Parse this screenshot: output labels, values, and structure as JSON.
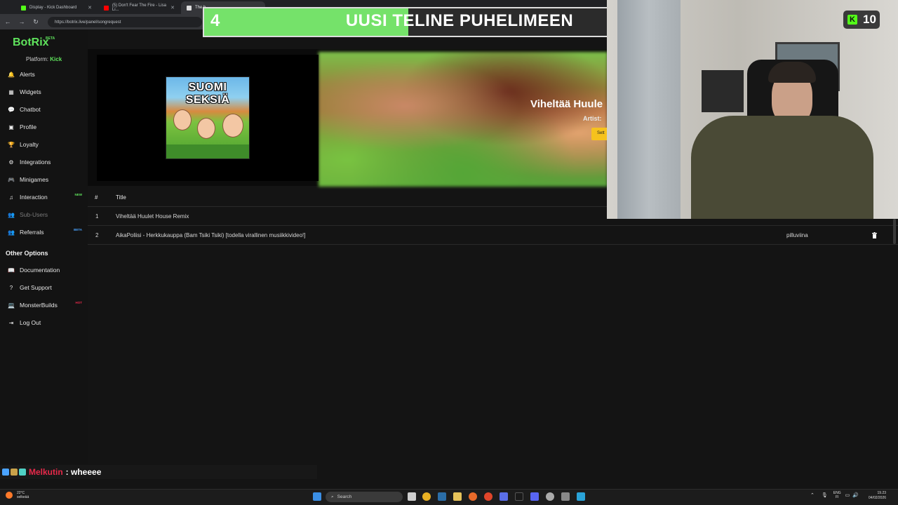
{
  "browser": {
    "tabs": [
      {
        "label": "Display - Kick Dashboard",
        "color": "#53fc18"
      },
      {
        "label": "(5) Don't Fear The Fire - Lisa Li...",
        "color": "#ff0000"
      },
      {
        "label": "The b...",
        "color": "#dddddd"
      }
    ],
    "url": "https://botrix.live/panel/songrequest"
  },
  "brand": {
    "name": "BotRix",
    "beta": "BETA"
  },
  "platform": {
    "label": "Platform:",
    "value": "Kick"
  },
  "nav": {
    "items": [
      {
        "label": "Alerts",
        "icon": "bell-icon",
        "glyph": "🔔"
      },
      {
        "label": "Widgets",
        "icon": "grid-icon",
        "glyph": "▦"
      },
      {
        "label": "Chatbot",
        "icon": "chat-icon",
        "glyph": "💬"
      },
      {
        "label": "Profile",
        "icon": "profile-icon",
        "glyph": "▣"
      },
      {
        "label": "Loyalty",
        "icon": "trophy-icon",
        "glyph": "🏆"
      },
      {
        "label": "Integrations",
        "icon": "integrations-icon",
        "glyph": "⚙"
      },
      {
        "label": "Minigames",
        "icon": "gamepad-icon",
        "glyph": "🎮"
      },
      {
        "label": "Interaction",
        "icon": "music-icon",
        "glyph": "♫",
        "badge": "NEW",
        "badge_color": "#5fe35c"
      },
      {
        "label": "Sub-Users",
        "icon": "users-icon",
        "glyph": "👥",
        "disabled": true
      },
      {
        "label": "Referrals",
        "icon": "referrals-icon",
        "glyph": "👥",
        "badge": "BETA",
        "badge_color": "#4aa3ff"
      }
    ],
    "other_options": "Other Options",
    "other_items": [
      {
        "label": "Documentation",
        "icon": "book-icon",
        "glyph": "📖"
      },
      {
        "label": "Get Support",
        "icon": "help-icon",
        "glyph": "?"
      },
      {
        "label": "MonsterBuilds",
        "icon": "laptop-icon",
        "glyph": "💻",
        "badge": "HOT",
        "badge_color": "#e8294a"
      },
      {
        "label": "Log Out",
        "icon": "logout-icon",
        "glyph": "⇥"
      }
    ]
  },
  "player": {
    "cover_title": "SUOMI SEKSIÄ",
    "song_title": "Viheltää Huule",
    "artist_label": "Artist:",
    "settings_label": "Sett"
  },
  "queue": {
    "headers": {
      "num": "#",
      "title": "Title"
    },
    "rows": [
      {
        "num": "1",
        "title": "Viheltää Huulet House Remix",
        "requester": ""
      },
      {
        "num": "2",
        "title": "AikaPoliisi - Herkkukauppa (Bam Tsiki Tsiki) [todella virallinen musiikkivideo!]",
        "requester": "pilluviina"
      }
    ]
  },
  "overlay": {
    "goal_current": "4",
    "goal_text": "UUSI TELINE PUHELIMEEN",
    "goal_target": "10",
    "goal_fraction": 0.4,
    "viewer_count": "10",
    "kick_glyph": "K"
  },
  "chat": {
    "user": "Melkutin",
    "message": ": wheeee"
  },
  "taskbar": {
    "weather_temp": "22°C",
    "weather_desc": "selkeää",
    "search": "Search",
    "lang1": "ENG",
    "lang2": "FI",
    "time": "19.23",
    "date": "04/02/2026"
  }
}
